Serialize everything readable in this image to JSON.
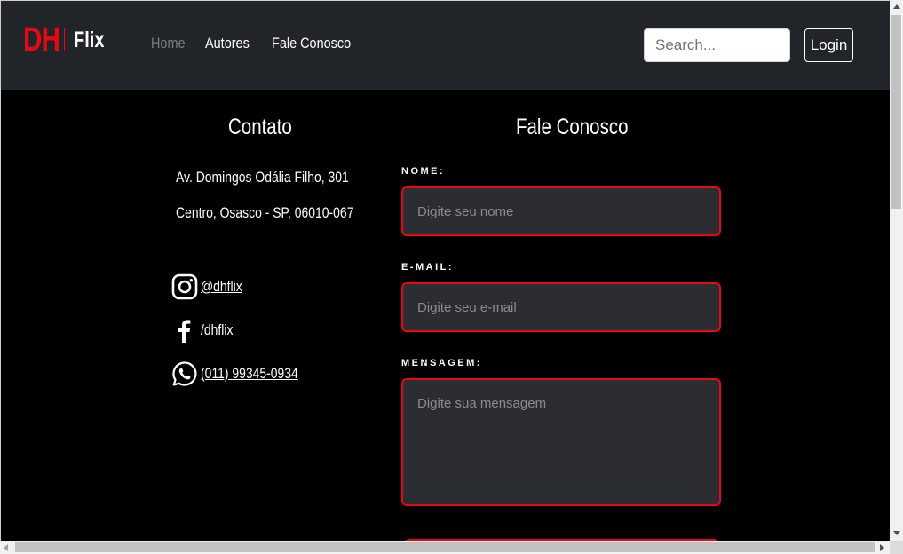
{
  "navbar": {
    "brand_dh": "DH",
    "brand_flix": "Flix",
    "links": [
      "Home",
      "Autores",
      "Fale Conosco"
    ],
    "search_placeholder": "Search...",
    "login_label": "Login"
  },
  "contact": {
    "title": "Contato",
    "address_line1": "Av. Domingos Odália Filho, 301",
    "address_line2": "Centro, Osasco - SP, 06010-067",
    "instagram": "@dhflix",
    "facebook": "/dhflix",
    "whatsapp": "(011) 99345-0934"
  },
  "form": {
    "title": "Fale Conosco",
    "name_label": "NOME:",
    "name_placeholder": "Digite seu nome",
    "email_label": "E-MAIL:",
    "email_placeholder": "Digite seu e-mail",
    "message_label": "MENSAGEM:",
    "message_placeholder": "Digite sua mensagem"
  },
  "colors": {
    "accent": "#e50914",
    "navbar_bg": "#212529",
    "page_bg": "#000000",
    "field_bg": "#2c2d32"
  },
  "icons": [
    "instagram-icon",
    "facebook-icon",
    "whatsapp-icon"
  ]
}
